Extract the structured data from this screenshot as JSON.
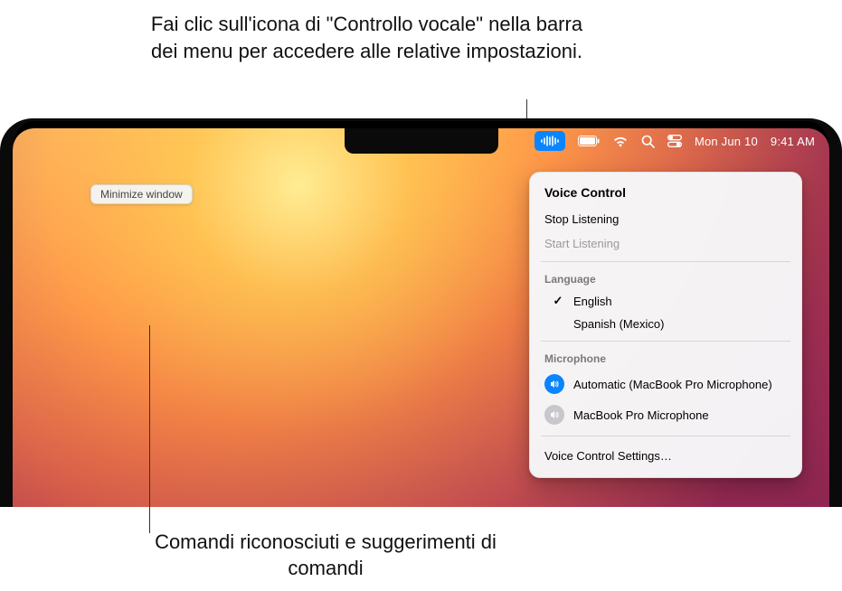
{
  "callouts": {
    "top": "Fai clic sull'icona di \"Controllo vocale\" nella barra dei menu per accedere alle relative impostazioni.",
    "bottom": "Comandi riconosciuti e suggerimenti di comandi"
  },
  "menubar": {
    "date": "Mon Jun 10",
    "time": "9:41 AM"
  },
  "command_bubble": "Minimize window",
  "dropdown": {
    "title": "Voice Control",
    "stop": "Stop Listening",
    "start": "Start Listening",
    "language_label": "Language",
    "languages": [
      {
        "name": "English",
        "selected": true
      },
      {
        "name": "Spanish (Mexico)",
        "selected": false
      }
    ],
    "microphone_label": "Microphone",
    "microphones": [
      {
        "name": "Automatic (MacBook Pro Microphone)",
        "active": true
      },
      {
        "name": "MacBook Pro Microphone",
        "active": false
      }
    ],
    "settings": "Voice Control Settings…"
  }
}
